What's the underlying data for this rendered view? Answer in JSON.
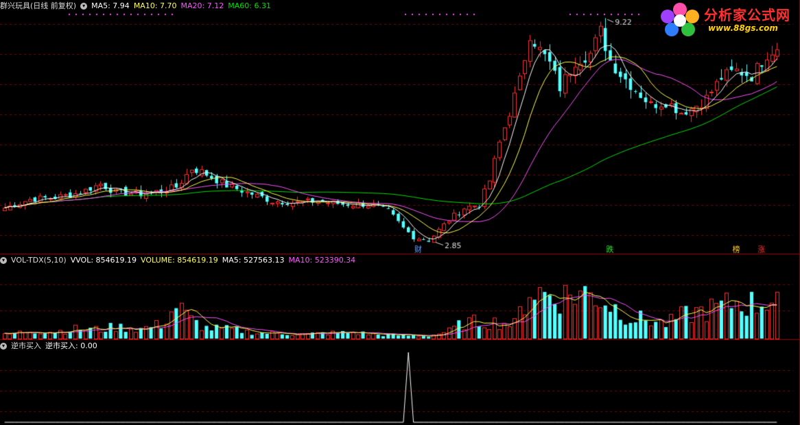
{
  "price_panel": {
    "title": "群兴玩具(日线 前复权)",
    "ma5_label": "MA5: 7.94",
    "ma10_label": "MA10: 7.70",
    "ma20_label": "MA20: 7.12",
    "ma60_label": "MA60: 6.31",
    "high_label": "9.22",
    "low_label": "2.85"
  },
  "volume_panel": {
    "title": "VOL-TDX(5,10)",
    "vvol_label": "VVOL: 854619.19",
    "volume_label": "VOLUME: 854619.19",
    "ma5_label": "MA5: 527563.13",
    "ma10_label": "MA10: 523390.34"
  },
  "indicator_panel": {
    "title": "逆市买入",
    "value_label": "逆市买入: 0.00"
  },
  "markers": [
    {
      "text": "财",
      "index": 82,
      "color": "#66a3ff"
    },
    {
      "text": "跌",
      "index": 120,
      "color": "#33dd33"
    },
    {
      "text": "榜",
      "index": 145,
      "color": "#ffcc33"
    },
    {
      "text": "涨",
      "index": 150,
      "color": "#ff3333"
    }
  ],
  "logo": {
    "text": "分析家公式网",
    "url": "www.88gs.com"
  },
  "colors": {
    "up": "#ff3030",
    "down": "#54ffff",
    "ma5": "#ffffff",
    "ma10": "#ffff54",
    "ma20": "#ff54ff",
    "ma60": "#00e000",
    "grid": "#800000",
    "frame": "#a00000"
  },
  "chart_data": {
    "type": "candlestick",
    "price_ylim": [
      2.6,
      9.6
    ],
    "high_value": 9.22,
    "low_value": 2.85,
    "volume_ylim": [
      0,
      1100000
    ],
    "close_anchors": [
      [
        0,
        3.9
      ],
      [
        5,
        4.15
      ],
      [
        10,
        4.2
      ],
      [
        15,
        4.35
      ],
      [
        19,
        4.6
      ],
      [
        22,
        4.35
      ],
      [
        27,
        4.3
      ],
      [
        31,
        4.4
      ],
      [
        34,
        4.5
      ],
      [
        37,
        5.05
      ],
      [
        39,
        4.95
      ],
      [
        44,
        4.55
      ],
      [
        49,
        4.3
      ],
      [
        53,
        4.1
      ],
      [
        58,
        4.05
      ],
      [
        62,
        4.1
      ],
      [
        67,
        4.0
      ],
      [
        72,
        4.0
      ],
      [
        76,
        3.8
      ],
      [
        79,
        3.3
      ],
      [
        81,
        3.05
      ],
      [
        84,
        2.95
      ],
      [
        88,
        3.55
      ],
      [
        91,
        3.9
      ],
      [
        94,
        4.0
      ],
      [
        96,
        4.7
      ],
      [
        98,
        5.8
      ],
      [
        100,
        6.7
      ],
      [
        102,
        7.6
      ],
      [
        104,
        9.0
      ],
      [
        106,
        8.5
      ],
      [
        108,
        8.1
      ],
      [
        110,
        7.4
      ],
      [
        113,
        8.2
      ],
      [
        116,
        8.4
      ],
      [
        118,
        9.05
      ],
      [
        120,
        8.2
      ],
      [
        122,
        7.8
      ],
      [
        124,
        7.5
      ],
      [
        126,
        7.2
      ],
      [
        128,
        6.9
      ],
      [
        131,
        7.0
      ],
      [
        134,
        6.7
      ],
      [
        136,
        6.8
      ],
      [
        139,
        7.1
      ],
      [
        142,
        7.7
      ],
      [
        145,
        7.9
      ],
      [
        148,
        7.75
      ],
      [
        151,
        8.4
      ],
      [
        153,
        8.6
      ]
    ],
    "volume_anchors": [
      [
        0,
        60000
      ],
      [
        5,
        120000
      ],
      [
        10,
        110000
      ],
      [
        14,
        150000
      ],
      [
        19,
        140000
      ],
      [
        22,
        180000
      ],
      [
        27,
        150000
      ],
      [
        31,
        220000
      ],
      [
        34,
        500000
      ],
      [
        37,
        280000
      ],
      [
        40,
        160000
      ],
      [
        45,
        140000
      ],
      [
        50,
        90000
      ],
      [
        55,
        80000
      ],
      [
        60,
        70000
      ],
      [
        65,
        90000
      ],
      [
        70,
        90000
      ],
      [
        74,
        60000
      ],
      [
        79,
        50000
      ],
      [
        84,
        40000
      ],
      [
        88,
        120000
      ],
      [
        91,
        240000
      ],
      [
        94,
        260000
      ],
      [
        98,
        250000
      ],
      [
        101,
        220000
      ],
      [
        104,
        750000
      ],
      [
        107,
        680000
      ],
      [
        110,
        640000
      ],
      [
        114,
        700000
      ],
      [
        117,
        660000
      ],
      [
        120,
        520000
      ],
      [
        124,
        320000
      ],
      [
        128,
        280000
      ],
      [
        131,
        220000
      ],
      [
        134,
        340000
      ],
      [
        138,
        420000
      ],
      [
        142,
        480000
      ],
      [
        145,
        560000
      ],
      [
        149,
        520000
      ],
      [
        152,
        640000
      ],
      [
        153,
        700000
      ]
    ],
    "indicator_spike": {
      "index": 80,
      "value": 1.0
    },
    "count": 154
  }
}
